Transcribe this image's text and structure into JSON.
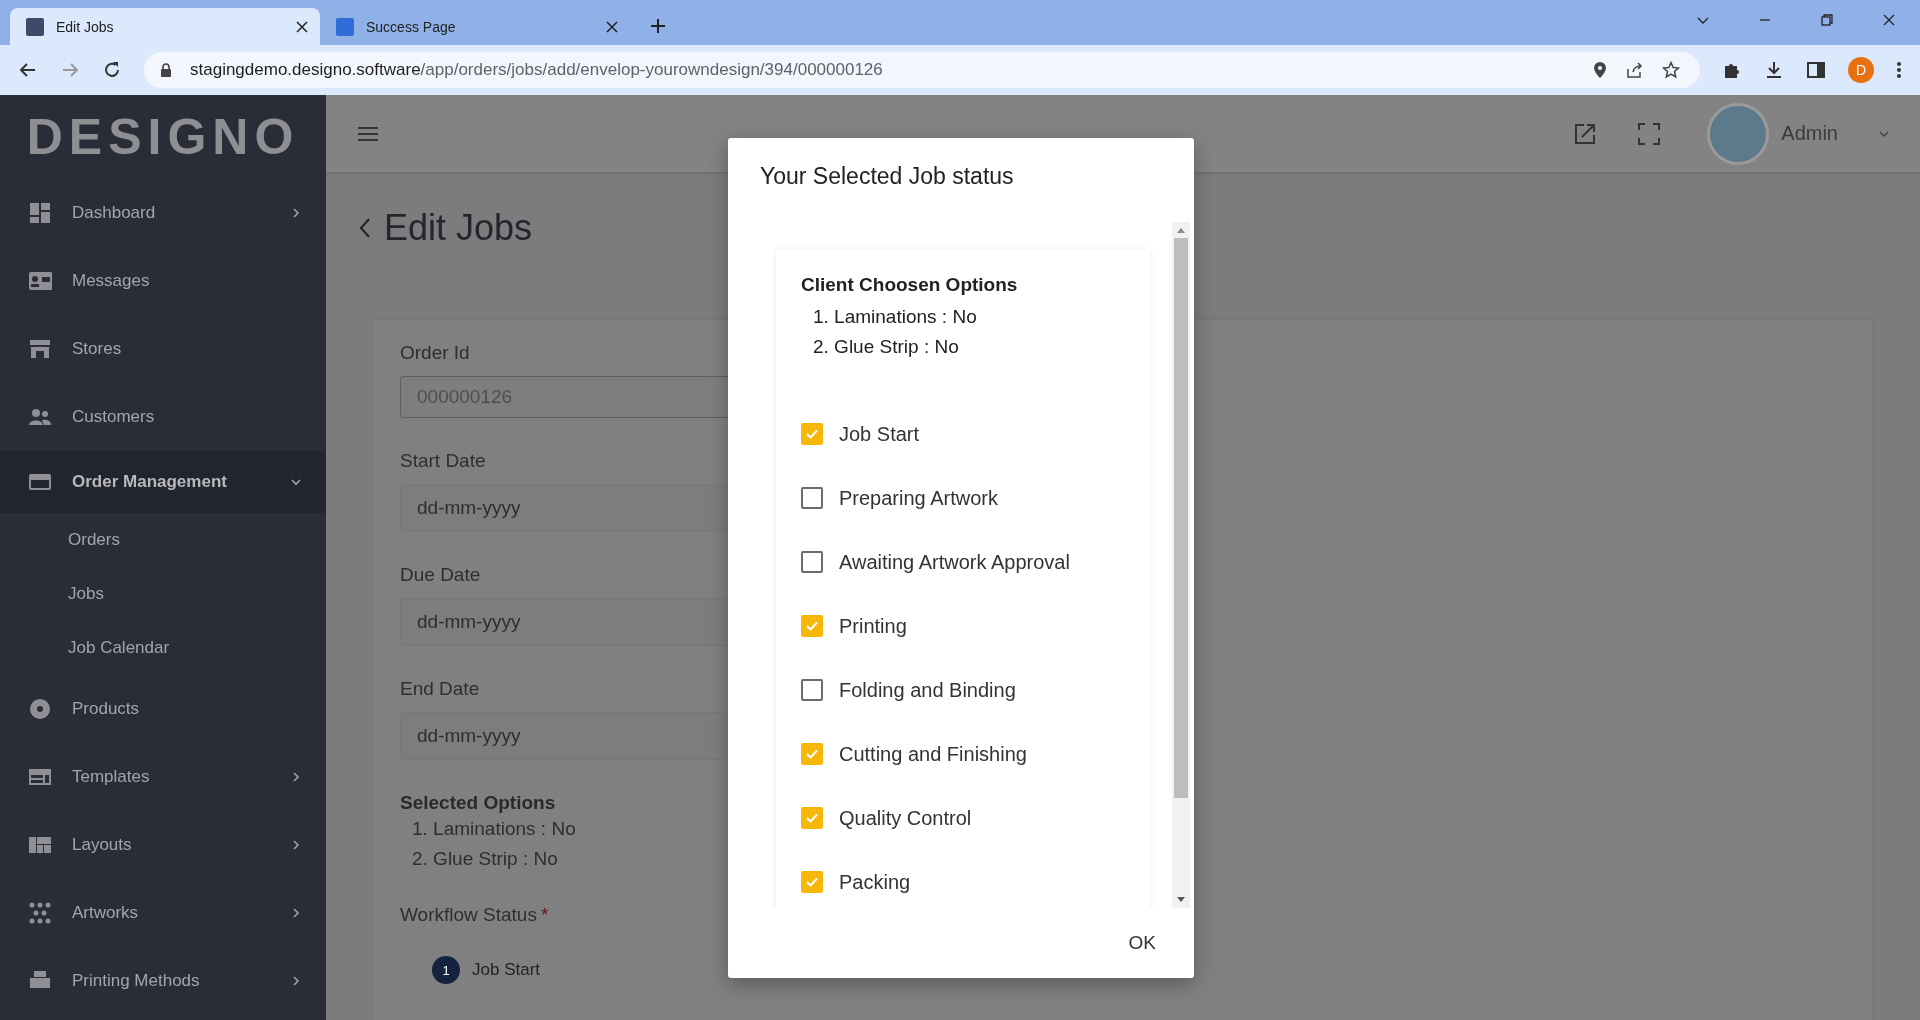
{
  "browser": {
    "tabs": [
      {
        "title": "Edit Jobs",
        "selected": true
      },
      {
        "title": "Success Page",
        "selected": false
      }
    ],
    "url": {
      "host": "stagingdemo.designo.software",
      "path": "/app/orders/jobs/add/envelop-yourowndesign/394/000000126"
    },
    "profile": "D"
  },
  "sidebar": {
    "logo": "DESIGNO",
    "items": [
      {
        "label": "Dashboard",
        "selected": false,
        "expanded": false
      },
      {
        "label": "Messages",
        "selected": false
      },
      {
        "label": "Stores",
        "selected": false
      },
      {
        "label": "Customers",
        "selected": false
      },
      {
        "label": "Order Management",
        "selected": true,
        "expanded": true,
        "children": [
          {
            "label": "Orders"
          },
          {
            "label": "Jobs"
          },
          {
            "label": "Job Calendar"
          }
        ]
      },
      {
        "label": "Products",
        "selected": false
      },
      {
        "label": "Templates",
        "selected": false,
        "expanded": false
      },
      {
        "label": "Layouts",
        "selected": false,
        "expanded": false
      },
      {
        "label": "Artworks",
        "selected": false,
        "expanded": false
      },
      {
        "label": "Printing Methods",
        "selected": false,
        "expanded": false
      }
    ]
  },
  "header": {
    "user": "Admin"
  },
  "page": {
    "title": "Edit Jobs",
    "fields": [
      {
        "label": "Order Id",
        "value": "000000126",
        "disabled": true
      },
      {
        "label": "Start Date",
        "value": "dd-mm-yyyy",
        "disabled": false
      },
      {
        "label": "Due Date",
        "value": "dd-mm-yyyy",
        "disabled": false
      },
      {
        "label": "End Date",
        "value": "dd-mm-yyyy",
        "disabled": false
      }
    ],
    "selected_options": {
      "title": "Selected Options",
      "items": [
        "1. Laminations : No",
        "2. Glue Strip : No"
      ]
    },
    "workflow": {
      "label": "Workflow Status",
      "required": "*",
      "steps": [
        {
          "number": "1",
          "label": "Job Start"
        }
      ]
    }
  },
  "dialog": {
    "title": "Your Selected Job status",
    "client_options": {
      "title": "Client Choosen Options",
      "items": [
        "1. Laminations : No",
        "2. Glue Strip : No"
      ]
    },
    "statuses": [
      {
        "label": "Job Start",
        "checked": true
      },
      {
        "label": "Preparing Artwork",
        "checked": false
      },
      {
        "label": "Awaiting Artwork Approval",
        "checked": false
      },
      {
        "label": "Printing",
        "checked": true
      },
      {
        "label": "Folding and Binding",
        "checked": false
      },
      {
        "label": "Cutting and Finishing",
        "checked": true
      },
      {
        "label": "Quality Control",
        "checked": true
      },
      {
        "label": "Packing",
        "checked": true
      }
    ],
    "ok": "OK"
  }
}
